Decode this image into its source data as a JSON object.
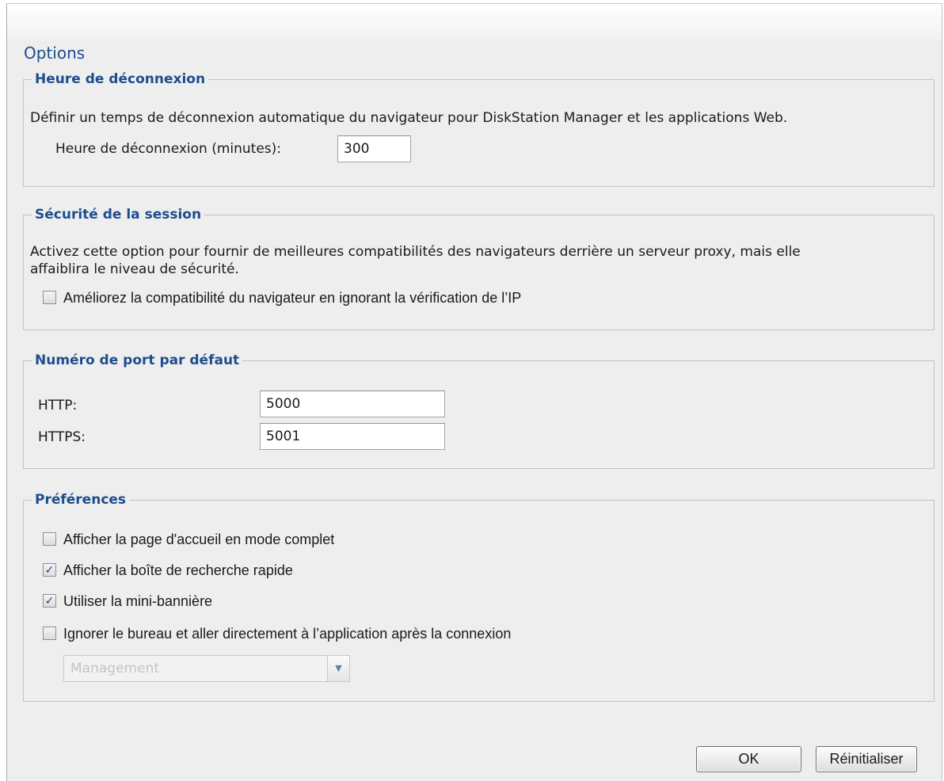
{
  "title": "Options",
  "logout": {
    "legend": "Heure de déconnexion",
    "description": "Définir un temps de déconnexion automatique du navigateur pour DiskStation Manager et les applications Web.",
    "field_label": "Heure de déconnexion (minutes):",
    "field_value": "300"
  },
  "session": {
    "legend": "Sécurité de la session",
    "description_line1": "Activez cette option pour fournir de meilleures compatibilités des navigateurs derrière un serveur proxy, mais elle",
    "description_line2": "affaiblira le niveau de sécurité.",
    "checkbox_label": "Améliorez la compatibilité du navigateur en ignorant la vérification de l’IP",
    "checkbox_checked": false
  },
  "ports": {
    "legend": "Numéro de port par défaut",
    "http_label": "HTTP:",
    "http_value": "5000",
    "https_label": "HTTPS:",
    "https_value": "5001"
  },
  "preferences": {
    "legend": "Préférences",
    "items": [
      {
        "label": "Afficher la page d'accueil en mode complet",
        "checked": false
      },
      {
        "label": "Afficher la boîte de recherche rapide",
        "checked": true
      },
      {
        "label": "Utiliser la mini-bannière",
        "checked": true
      },
      {
        "label": "Ignorer le bureau et aller directement à l’application après la connexion",
        "checked": false
      }
    ],
    "app_select_value": "Management"
  },
  "buttons": {
    "ok_label": "OK",
    "reset_label": "Réinitialiser"
  },
  "icons": {
    "checkmark": "checkmark-icon",
    "dropdown": "chevron-down-icon"
  },
  "colors": {
    "title": "#1a4c8e",
    "legend": "#1d4d8d",
    "background": "#eeeeee",
    "checkmark": "#1f3f86"
  }
}
